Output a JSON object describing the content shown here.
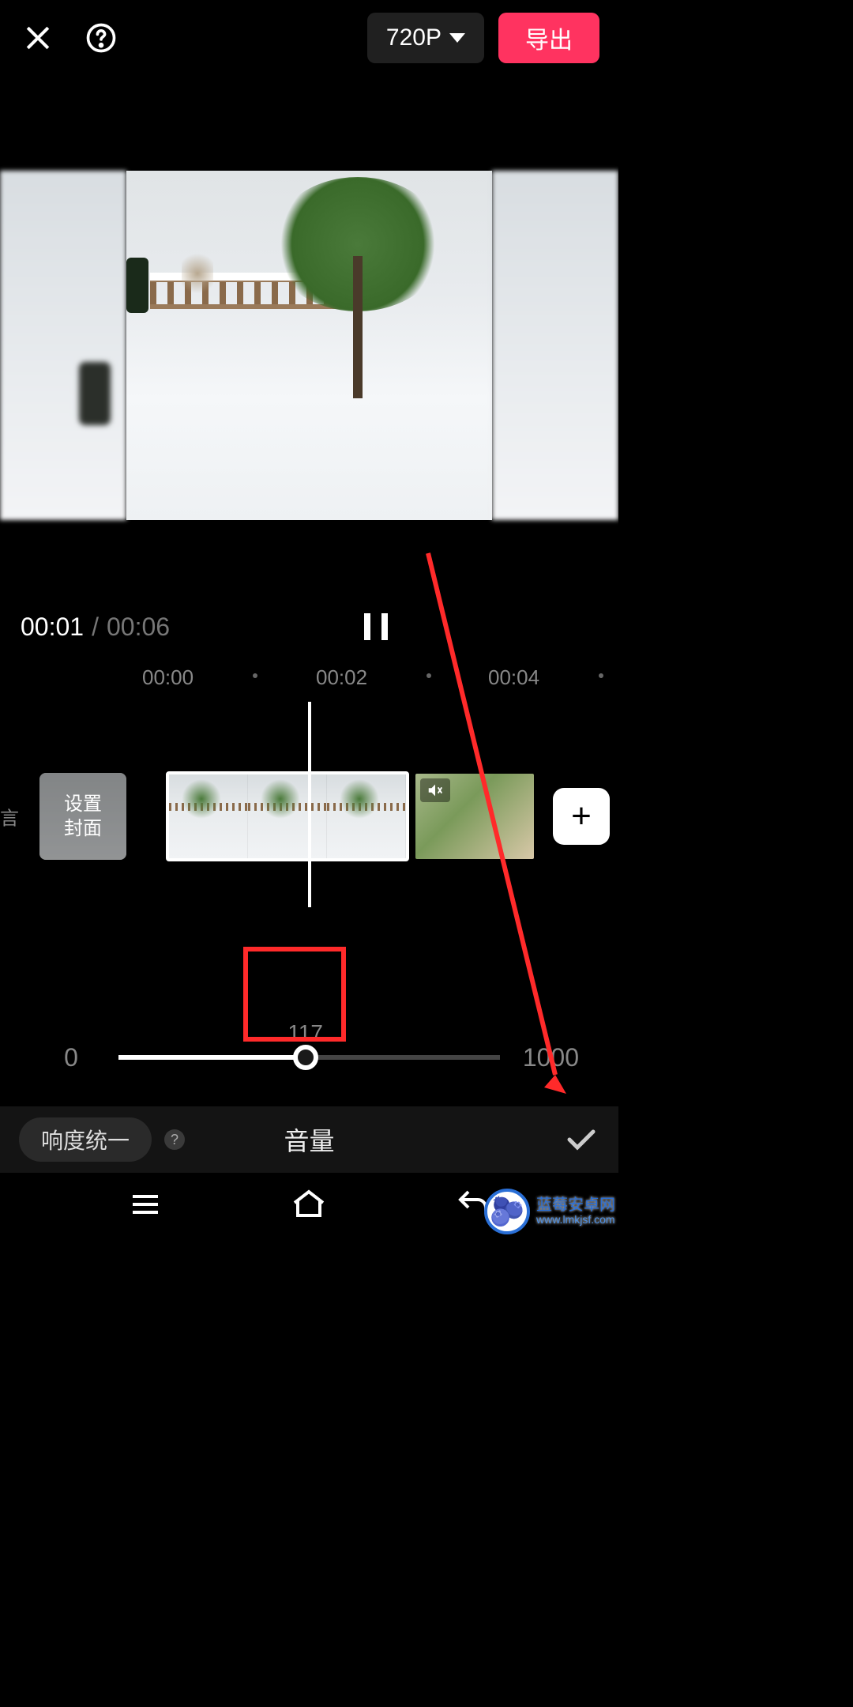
{
  "header": {
    "resolution": "720P",
    "export_label": "导出"
  },
  "playback": {
    "current_time": "00:01",
    "total_time": "00:06"
  },
  "ruler": {
    "ticks": [
      "00:00",
      "00:02",
      "00:04"
    ]
  },
  "timeline": {
    "cover_line1": "设置",
    "cover_line2": "封面",
    "edge_label": "言",
    "add_label": "+",
    "mute_icon": "speaker-mute-icon"
  },
  "slider": {
    "min": "0",
    "max": "1000",
    "value": "117",
    "percent": 49
  },
  "toolrow": {
    "pill_label": "响度统一",
    "help_glyph": "?",
    "title": "音量"
  },
  "watermark": {
    "emoji": "🫐",
    "title": "蓝莓安卓网",
    "url": "www.lmkjsf.com"
  }
}
